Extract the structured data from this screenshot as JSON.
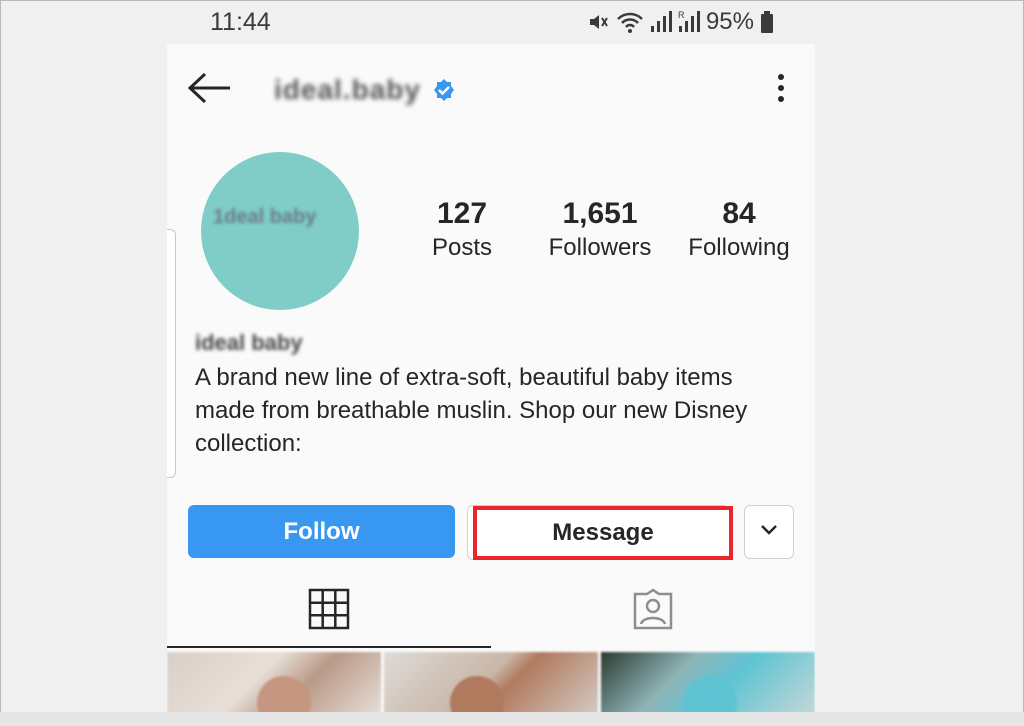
{
  "status_bar": {
    "time": "11:44",
    "battery": "95%",
    "icons": [
      "mute-icon",
      "wifi-icon",
      "signal-icon",
      "roaming-signal-icon",
      "battery-icon"
    ]
  },
  "header": {
    "username": "ideal.baby",
    "verified": true,
    "back_icon": "back-arrow-icon",
    "menu_icon": "more-vert-icon"
  },
  "profile": {
    "avatar_logo_text": "1deal baby",
    "avatar_color": "#7fcdc6",
    "stats": [
      {
        "value": "127",
        "label": "Posts"
      },
      {
        "value": "1,651",
        "label": "Followers"
      },
      {
        "value": "84",
        "label": "Following"
      }
    ],
    "display_name": "ideal baby",
    "bio": "A brand new line of extra-soft, beautiful baby items made from breathable muslin. Shop our new Disney collection:"
  },
  "actions": {
    "follow_label": "Follow",
    "message_label": "Message",
    "dropdown_icon": "chevron-down-icon",
    "follow_color": "#3897f0",
    "highlight_color": "#e8262b"
  },
  "tabs": [
    {
      "name": "grid",
      "icon": "grid-icon",
      "active": true
    },
    {
      "name": "tagged",
      "icon": "tagged-person-icon",
      "active": false
    }
  ]
}
